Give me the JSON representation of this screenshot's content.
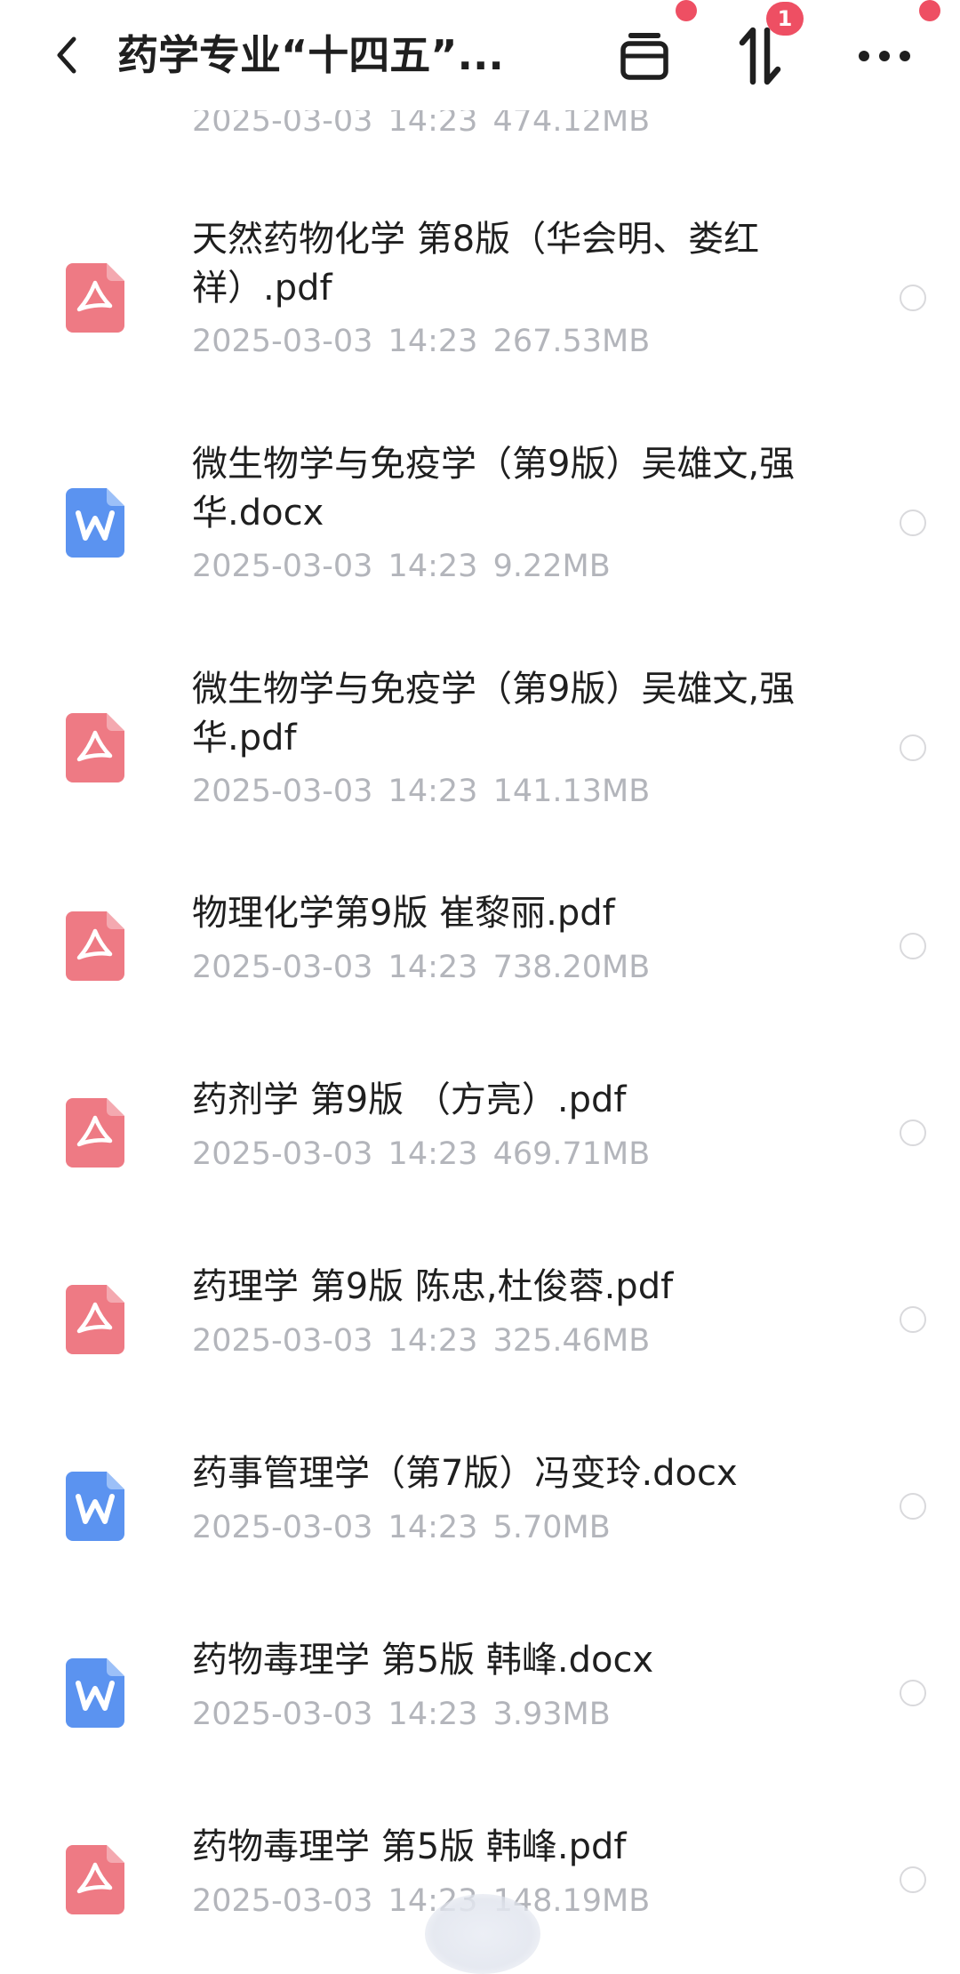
{
  "header": {
    "title": "药学专业“十四五”...",
    "sort_badge": "1",
    "icons": [
      "back-arrow-icon",
      "archive-icon",
      "sort-icon",
      "more-icon"
    ],
    "accent_color": "#ee4f63"
  },
  "top_partial_meta": "2025-03-03 14:23 474.12MB",
  "files": [
    {
      "type": "pdf",
      "name": "天然药物化学 第8版（华会明、娄红祥）.pdf",
      "date": "2025-03-03",
      "time": "14:23",
      "size": "267.53MB"
    },
    {
      "type": "docx",
      "name": "微生物学与免疫学（第9版）吴雄文,强华.docx",
      "date": "2025-03-03",
      "time": "14:23",
      "size": "9.22MB"
    },
    {
      "type": "pdf",
      "name": "微生物学与免疫学（第9版）吴雄文,强华.pdf",
      "date": "2025-03-03",
      "time": "14:23",
      "size": "141.13MB"
    },
    {
      "type": "pdf",
      "name": "物理化学第9版 崔黎丽.pdf",
      "date": "2025-03-03",
      "time": "14:23",
      "size": "738.20MB"
    },
    {
      "type": "pdf",
      "name": "药剂学 第9版 （方亮）.pdf",
      "date": "2025-03-03",
      "time": "14:23",
      "size": "469.71MB"
    },
    {
      "type": "pdf",
      "name": "药理学 第9版 陈忠,杜俊蓉.pdf",
      "date": "2025-03-03",
      "time": "14:23",
      "size": "325.46MB"
    },
    {
      "type": "docx",
      "name": "药事管理学（第7版）冯变玲.docx",
      "date": "2025-03-03",
      "time": "14:23",
      "size": "5.70MB"
    },
    {
      "type": "docx",
      "name": "药物毒理学 第5版 韩峰.docx",
      "date": "2025-03-03",
      "time": "14:23",
      "size": "3.93MB"
    },
    {
      "type": "pdf",
      "name": "药物毒理学 第5版 韩峰.pdf",
      "date": "2025-03-03",
      "time": "14:23",
      "size": "148.19MB"
    }
  ],
  "colors": {
    "pdf_icon": "#ee7a84",
    "doc_icon": "#5b93f0",
    "meta_text": "#b3b5bb"
  }
}
